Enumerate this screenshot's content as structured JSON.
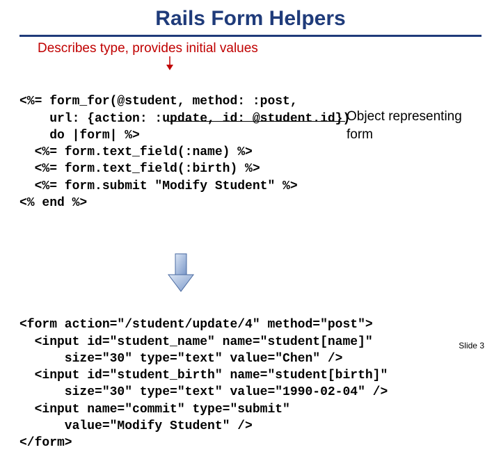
{
  "title": "Rails Form Helpers",
  "subtitle": "Describes type, provides initial values",
  "annotation_object": "Object representing form",
  "code_top": {
    "l1": "<%= form_for(@student, method: :post,",
    "l2": "    url: {action: :update, id: @student.id})",
    "l3": "    do |form| %>",
    "l4": "  <%= form.text_field(:name) %>",
    "l5": "  <%= form.text_field(:birth) %>",
    "l6": "  <%= form.submit \"Modify Student\" %>",
    "l7": "<% end %>"
  },
  "code_bottom": {
    "l1": "<form action=\"/student/update/4\" method=\"post\">",
    "l2": "  <input id=\"student_name\" name=\"student[name]\"",
    "l3": "      size=\"30\" type=\"text\" value=\"Chen\" />",
    "l4": "  <input id=\"student_birth\" name=\"student[birth]\"",
    "l5": "      size=\"30\" type=\"text\" value=\"1990-02-04\" />",
    "l6": "  <input name=\"commit\" type=\"submit\"",
    "l7": "      value=\"Modify Student\" />",
    "l8": "</form>"
  },
  "slide_number": "Slide 3"
}
